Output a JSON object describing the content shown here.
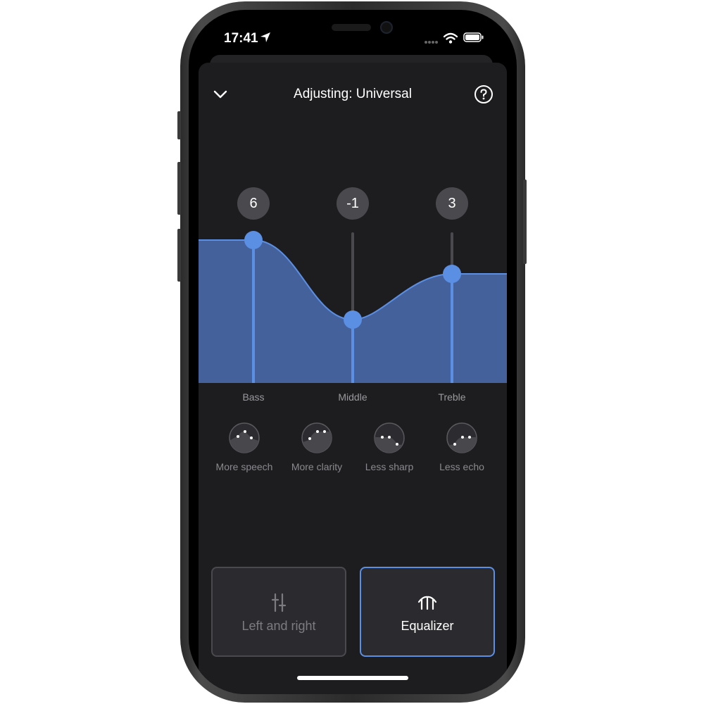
{
  "status_bar": {
    "time": "17:41"
  },
  "header": {
    "title": "Adjusting: Universal"
  },
  "equalizer": {
    "bands": [
      {
        "label": "Bass",
        "value": "6"
      },
      {
        "label": "Middle",
        "value": "-1"
      },
      {
        "label": "Treble",
        "value": "3"
      }
    ],
    "accent_color": "#5b8fe3",
    "fill_color": "#44619c"
  },
  "presets": [
    {
      "label": "More speech"
    },
    {
      "label": "More clarity"
    },
    {
      "label": "Less sharp"
    },
    {
      "label": "Less echo"
    }
  ],
  "modes": {
    "left_right": {
      "label": "Left and right"
    },
    "equalizer": {
      "label": "Equalizer"
    }
  }
}
